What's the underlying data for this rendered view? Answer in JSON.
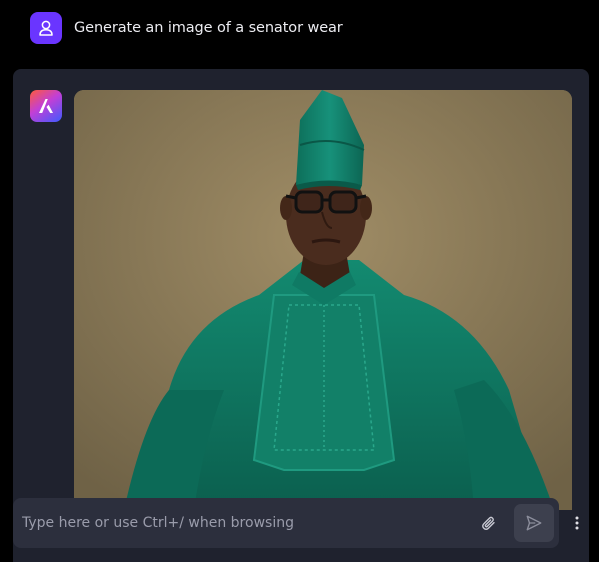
{
  "user_message": {
    "text": "Generate an image of a senator wear",
    "avatar_icon": "user-icon",
    "avatar_color": "#6a35ff"
  },
  "assistant_message": {
    "avatar_icon": "assistant-logo-icon",
    "image_subject": "man in green senator attire with cap and glasses",
    "image_palette": {
      "background": "#8f7f5c",
      "garment": "#0f7a64",
      "skin": "#4a2c1e"
    }
  },
  "composer": {
    "placeholder": "Type here or use Ctrl+/ when browsing",
    "value": "",
    "attach_icon": "paperclip-icon",
    "send_icon": "send-icon",
    "more_icon": "more-vertical-icon"
  },
  "colors": {
    "page_background": "#000000",
    "panel_background": "#1f222e",
    "composer_background": "#2c2f3d",
    "send_button_background": "#3d404e"
  }
}
